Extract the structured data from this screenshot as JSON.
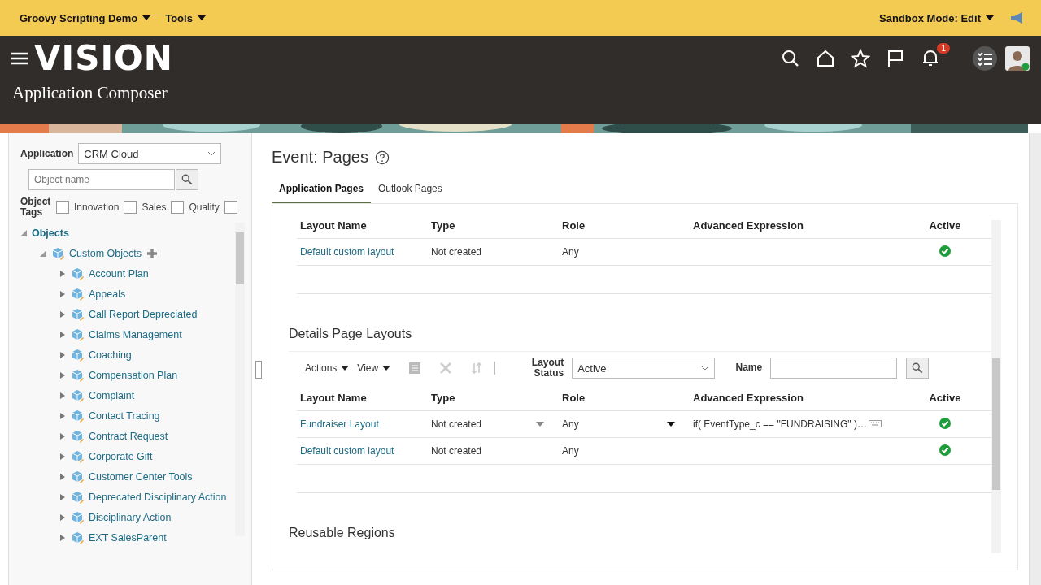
{
  "top_bar": {
    "menus": [
      "Groovy Scripting Demo",
      "Tools"
    ],
    "sandbox": "Sandbox Mode: Edit"
  },
  "header": {
    "logo": "VISION",
    "title": "Application Composer",
    "notifications": "1"
  },
  "sidebar": {
    "application_label": "Application",
    "application": "CRM Cloud",
    "search": {
      "placeholder": "Object name"
    },
    "tags_label": "Object Tags",
    "tags": [
      {
        "label": "Innovation",
        "checked": false
      },
      {
        "label": "Sales",
        "checked": false
      },
      {
        "label": "Quality",
        "checked": false
      },
      {
        "checked": false
      }
    ],
    "tree": [
      {
        "label": "Objects",
        "expanded": true,
        "children": [
          {
            "label": "Custom Objects",
            "expanded": true,
            "children": [
              {
                "label": "Account Plan",
                "expanded": false
              },
              {
                "label": "Appeals",
                "expanded": false
              },
              {
                "label": "Call Report Depreciated",
                "expanded": false
              },
              {
                "label": "Claims Management",
                "expanded": false
              },
              {
                "label": "Coaching",
                "expanded": false
              },
              {
                "label": "Compensation Plan",
                "expanded": false
              },
              {
                "label": "Complaint",
                "expanded": false
              },
              {
                "label": "Contact Tracing",
                "expanded": false
              },
              {
                "label": "Contract Request",
                "expanded": false
              },
              {
                "label": "Corporate Gift",
                "expanded": false
              },
              {
                "label": "Customer Center Tools",
                "expanded": false
              },
              {
                "label": "Deprecated Disciplinary Action",
                "expanded": false
              },
              {
                "label": "Disciplinary Action",
                "expanded": false
              },
              {
                "label": "EXT SalesParent",
                "expanded": false
              }
            ]
          }
        ]
      }
    ]
  },
  "main": {
    "title": "Event: Pages",
    "tabs": [
      {
        "label": "Application Pages",
        "selected": true
      },
      {
        "label": "Outlook Pages",
        "selected": false
      }
    ],
    "table_1": {
      "columns": [
        "Layout Name",
        "Type",
        "Role",
        "Advanced Expression",
        "Active"
      ],
      "rows": [
        {
          "name": "Default custom layout",
          "type": "Not created",
          "role": "Any",
          "active": true
        }
      ]
    },
    "details_title": "Details Page Layouts",
    "toolbar": {
      "menus": [
        "Actions",
        "View"
      ],
      "status_label": "Layout Status",
      "status": "Active",
      "name_label": "Name"
    },
    "table_2": {
      "columns": [
        "Layout Name",
        "Type",
        "Role",
        "Advanced Expression",
        "Active"
      ],
      "rows": [
        {
          "name": "Fundraiser Layout",
          "type": "Not created",
          "role": "Any",
          "expression": "if( EventType_c == \"FUNDRAISING\" )…",
          "editable": true,
          "active": true
        },
        {
          "name": "Default custom layout",
          "type": "Not created",
          "role": "Any",
          "editable": false,
          "active": true
        }
      ]
    },
    "reusable_title": "Reusable Regions"
  }
}
